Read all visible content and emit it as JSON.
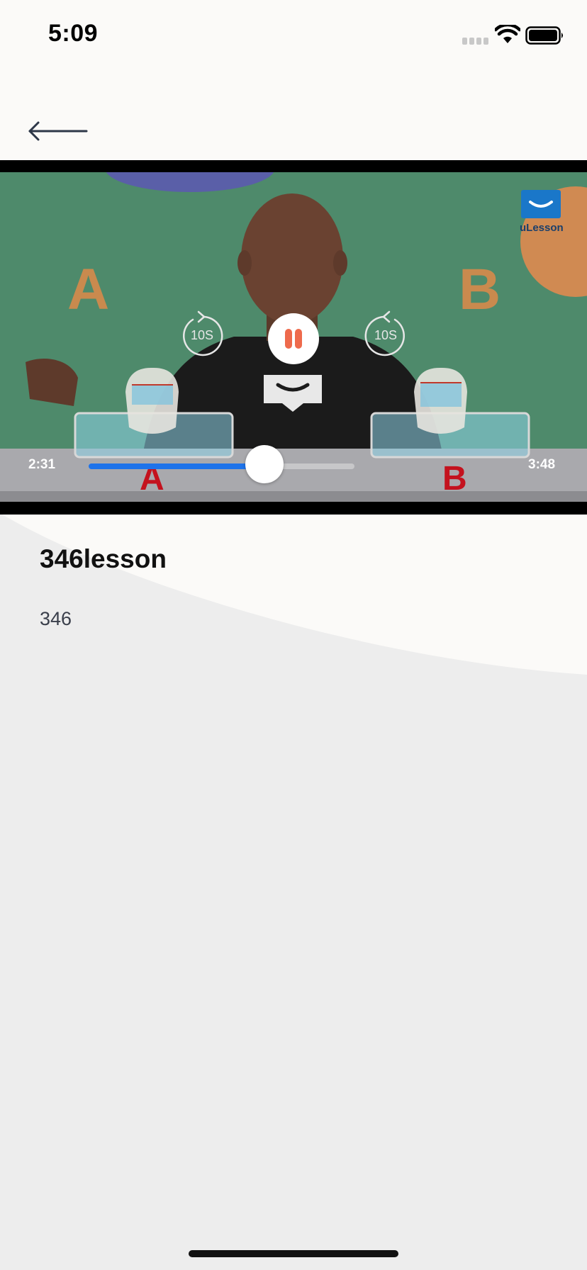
{
  "status_bar": {
    "time": "5:09",
    "icons": [
      "cellular-signal-icon",
      "wifi-icon",
      "battery-icon"
    ]
  },
  "nav": {
    "back_icon": "arrow-left-icon"
  },
  "video": {
    "brand_watermark": "uLesson",
    "skip_back_label": "10S",
    "skip_forward_label": "10S",
    "play_state": "playing",
    "current_time": "2:31",
    "total_time": "3:48",
    "progress_fraction": 0.662,
    "accent_color": "#1e73ea",
    "pause_icon_color": "#ee6a4c"
  },
  "lesson": {
    "title": "346lesson",
    "subtitle": "346"
  }
}
